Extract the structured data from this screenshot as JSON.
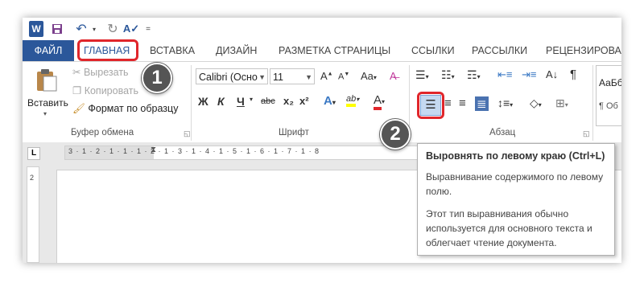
{
  "quick_access": {
    "word_icon": "W",
    "save_icon": "floppy-icon",
    "undo_icon": "undo-icon",
    "redo_icon": "redo-icon",
    "format_icon": "spellcheck-icon",
    "customize": "="
  },
  "tabs": [
    "ФАЙЛ",
    "ГЛАВНАЯ",
    "ВСТАВКА",
    "ДИЗАЙН",
    "РАЗМЕТКА СТРАНИЦЫ",
    "ССЫЛКИ",
    "РАССЫЛКИ",
    "РЕЦЕНЗИРОВАН"
  ],
  "clipboard": {
    "paste": "Вставить",
    "cut": "Вырезать",
    "copy": "Копировать",
    "format_painter": "Формат по образцу",
    "group_label": "Буфер обмена"
  },
  "font": {
    "name": "Calibri (Осно",
    "size": "11",
    "grow": "A",
    "shrink": "A",
    "case": "Aa",
    "bold": "Ж",
    "italic": "К",
    "underline": "Ч",
    "strike": "abc",
    "sub": "x₂",
    "sup": "x²",
    "text_effects": "A",
    "highlight": "ab",
    "font_color": "A",
    "group_label": "Шрифт"
  },
  "paragraph": {
    "group_label": "Абзац",
    "pilcrow": "¶"
  },
  "styles": {
    "preview": "АаБб",
    "style_name": "¶ Об"
  },
  "ruler": {
    "tab_marker": "L",
    "ticks": "3 · 1 · 2 · 1 · 1 · 1 · 2 · 1 · 3 · 1 · 4 · 1 · 5 · 1 · 6 · 1 · 7 · 1 · 8",
    "vertical_mark": "2"
  },
  "tooltip": {
    "title": "Выровнять по левому краю (Ctrl+L)",
    "line1": "Выравнивание содержимого по левому полю.",
    "line2": "Этот тип выравнивания обычно используется для основного текста и облегчает чтение документа."
  },
  "badges": [
    "1",
    "2"
  ],
  "colors": {
    "accent": "#2b579a",
    "highlight_red": "#e0262b",
    "highlight_yellow": "#ffff00",
    "font_red": "#e0262b"
  }
}
